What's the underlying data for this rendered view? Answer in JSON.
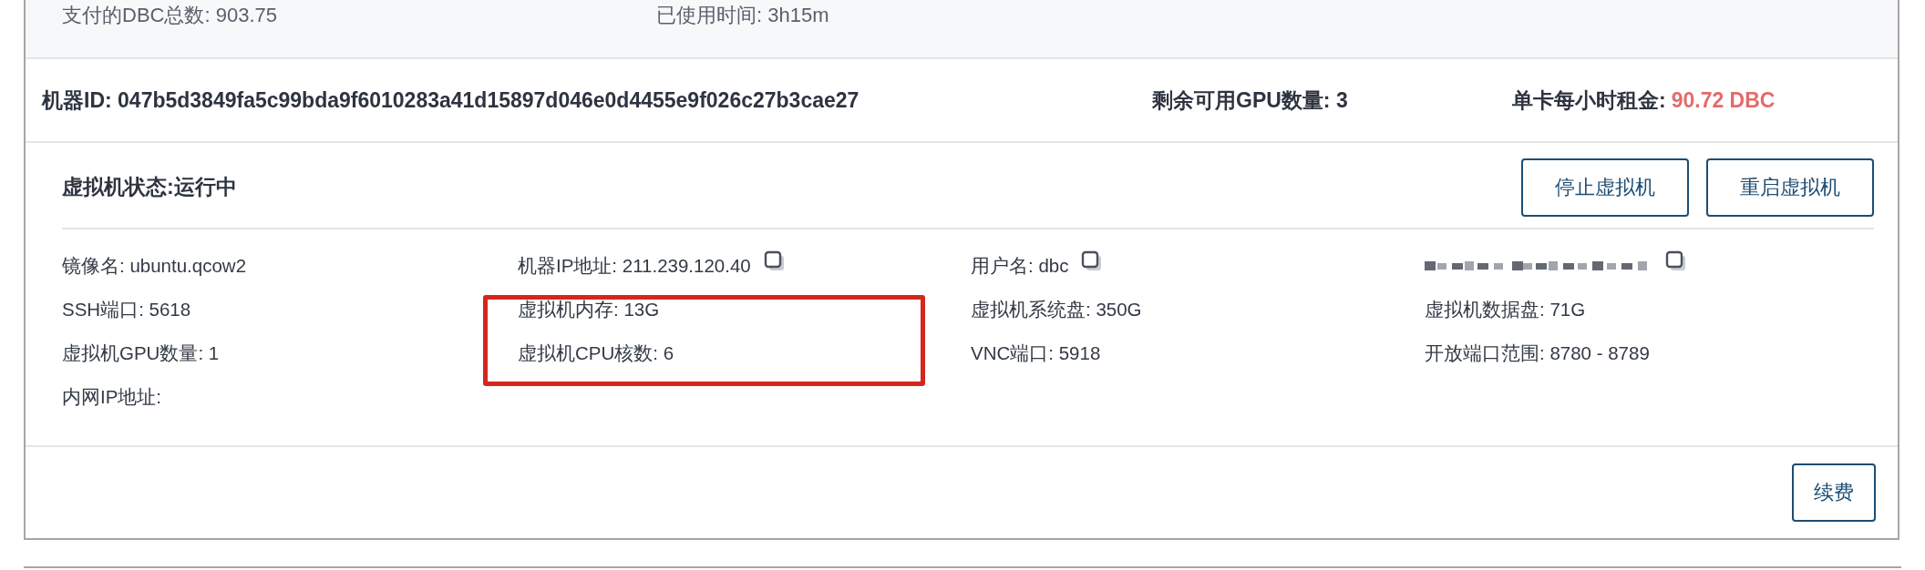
{
  "summary": [
    {
      "label": "支付的DBC总数:",
      "value": "903.75"
    },
    {
      "label": "已使用时间:",
      "value": "3h15m"
    }
  ],
  "machine": {
    "id_label": "机器ID:",
    "id": "047b5d3849fa5c99bda9f6010283a41d15897d046e0d4455e9f026c27b3cae27",
    "gpu_label": "剩余可用GPU数量:",
    "gpu": "3",
    "rent_label": "单卡每小时租金:",
    "rent": "90.72 DBC"
  },
  "vm": {
    "status_title": "虚拟机状态:运行中",
    "buttons": [
      "停止虚拟机",
      "重启虚拟机"
    ],
    "fields": [
      {
        "kind": "plain",
        "text": "镜像名: ubuntu.qcow2"
      },
      {
        "kind": "copyable",
        "text": "机器IP地址: 211.239.120.40"
      },
      {
        "kind": "copyable",
        "text": "用户名: dbc"
      },
      {
        "kind": "redacted"
      },
      {
        "kind": "plain",
        "text": "SSH端口: 5618"
      },
      {
        "kind": "plain",
        "text": "虚拟机内存: 13G"
      },
      {
        "kind": "plain",
        "text": "虚拟机系统盘: 350G"
      },
      {
        "kind": "plain",
        "text": "虚拟机数据盘: 71G"
      },
      {
        "kind": "plain",
        "text": "虚拟机GPU数量: 1"
      },
      {
        "kind": "plain",
        "text": "虚拟机CPU核数: 6"
      },
      {
        "kind": "plain",
        "text": "VNC端口: 5918"
      },
      {
        "kind": "plain",
        "text": "开放端口范围: 8780 - 8789"
      },
      {
        "kind": "plain",
        "text": "内网IP地址:"
      }
    ],
    "annotations": [
      {
        "kind": "highlight-box"
      }
    ],
    "footer_button": "续费"
  }
}
